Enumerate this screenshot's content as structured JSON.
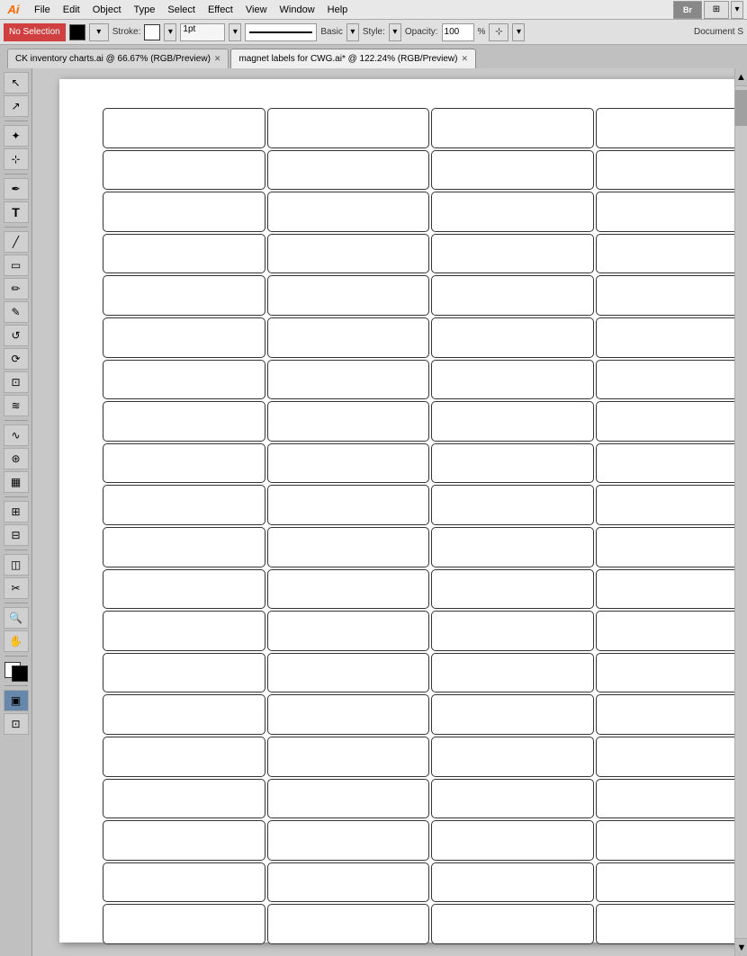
{
  "menubar": {
    "logo": "Ai",
    "menus": [
      "File",
      "Edit",
      "Object",
      "Type",
      "Select",
      "Effect",
      "View",
      "Window",
      "Help"
    ]
  },
  "toolbar": {
    "no_selection_label": "No Selection",
    "stroke_label": "Stroke:",
    "basic_label": "Basic",
    "style_label": "Style:",
    "opacity_label": "Opacity:",
    "opacity_value": "100",
    "percent_symbol": "%",
    "document_label": "Document S"
  },
  "tabs": [
    {
      "id": "tab1",
      "label": "CK inventory charts.ai @ 66.67% (RGB/Preview)",
      "active": false
    },
    {
      "id": "tab2",
      "label": "magnet labels for CWG.ai* @ 122.24% (RGB/Preview)",
      "active": true
    }
  ],
  "tools": [
    "↖",
    "⊹",
    "✏",
    "⊡",
    "◯",
    "✒",
    "⌂",
    "T",
    "⁄",
    "▭",
    "🖊",
    "✂",
    "⊕",
    "↺",
    "⊞",
    "⊟",
    "◈",
    "⊙",
    "⊛",
    "∿",
    "⊠",
    "✦",
    "⟳",
    "⊡",
    "🔍",
    "⊿"
  ],
  "grid": {
    "columns": 4,
    "rows": 20
  }
}
